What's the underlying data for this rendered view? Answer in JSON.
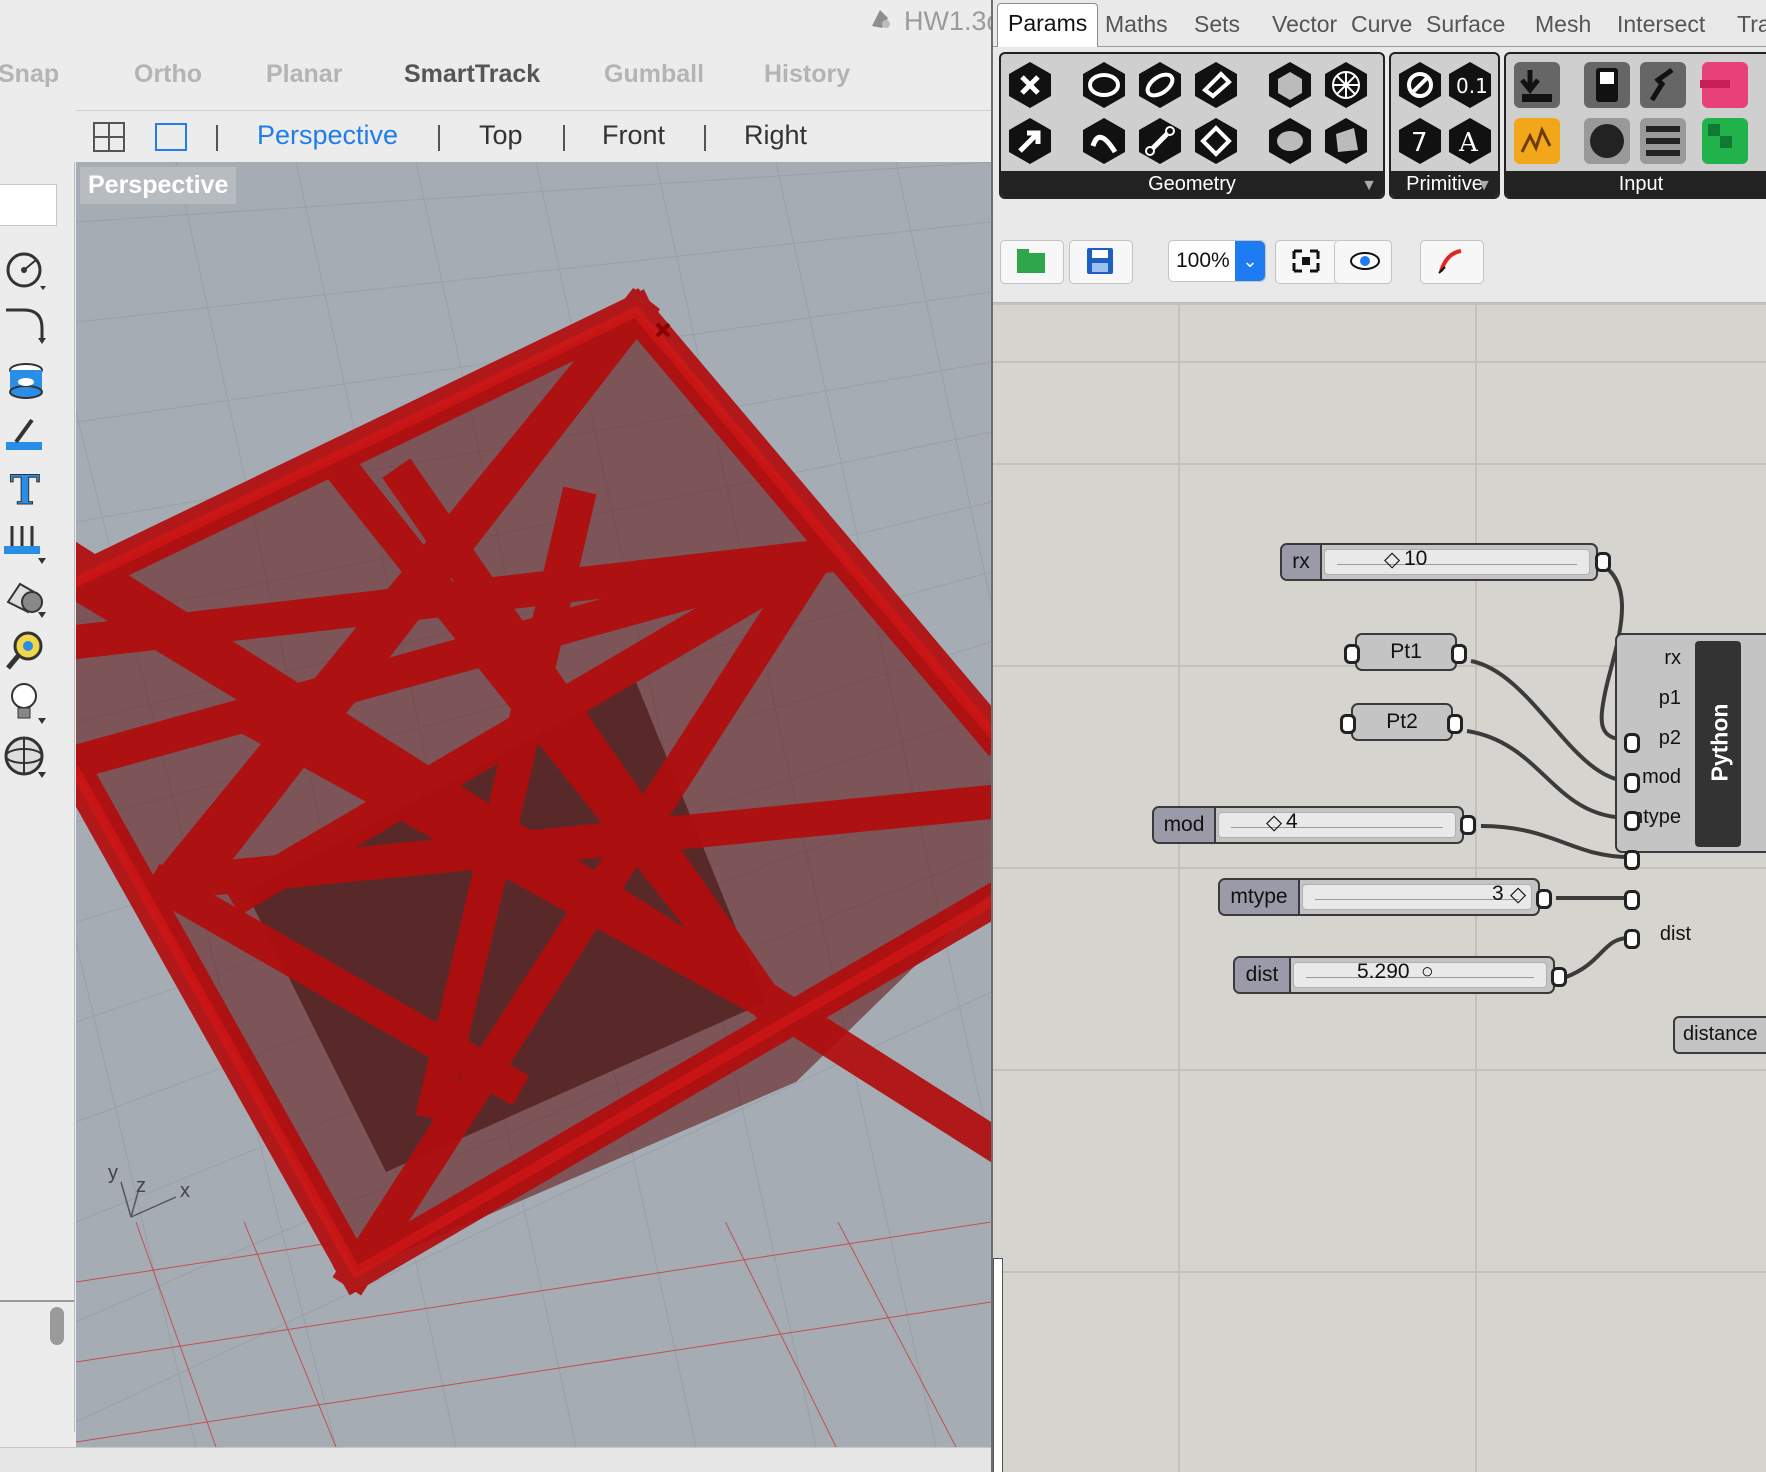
{
  "rhino": {
    "window_title": "HW1.3d",
    "osnap": [
      "Snap",
      "Ortho",
      "Planar",
      "SmartTrack",
      "Gumball",
      "History"
    ],
    "view_tabs": [
      "Perspective",
      "Top",
      "Front",
      "Right"
    ],
    "viewport_label": "Perspective",
    "axis_labels": {
      "x": "x",
      "y": "y",
      "z": "z"
    },
    "model_color": "#c40a0a",
    "left_tools": [
      "circle-tool-icon",
      "curve-fillet-icon",
      "solid-extrude-icon",
      "dimension-icon",
      "text-icon",
      "array-icon",
      "boolean-icon",
      "analyze-icon",
      "render-light-icon",
      "globe-sphere-icon"
    ]
  },
  "grasshopper": {
    "tabs": [
      "Params",
      "Maths",
      "Sets",
      "Vector",
      "Curve",
      "Surface",
      "Mesh",
      "Intersect",
      "Tra"
    ],
    "panels": [
      "Geometry",
      "Primitive",
      "Input"
    ],
    "zoom": "100%",
    "components": {
      "rx": {
        "label": "rx",
        "value": "10"
      },
      "pt1": {
        "label": "Pt1"
      },
      "pt2": {
        "label": "Pt2"
      },
      "mod": {
        "label": "mod",
        "value": "4"
      },
      "mtype": {
        "label": "mtype",
        "value": "3"
      },
      "dist": {
        "label": "dist",
        "value": "5.290"
      },
      "python": {
        "name": "Python",
        "inputs": [
          "rx",
          "p1",
          "p2",
          "mod",
          "mtype",
          "dist"
        ]
      },
      "distance": {
        "label": "distance"
      }
    }
  }
}
